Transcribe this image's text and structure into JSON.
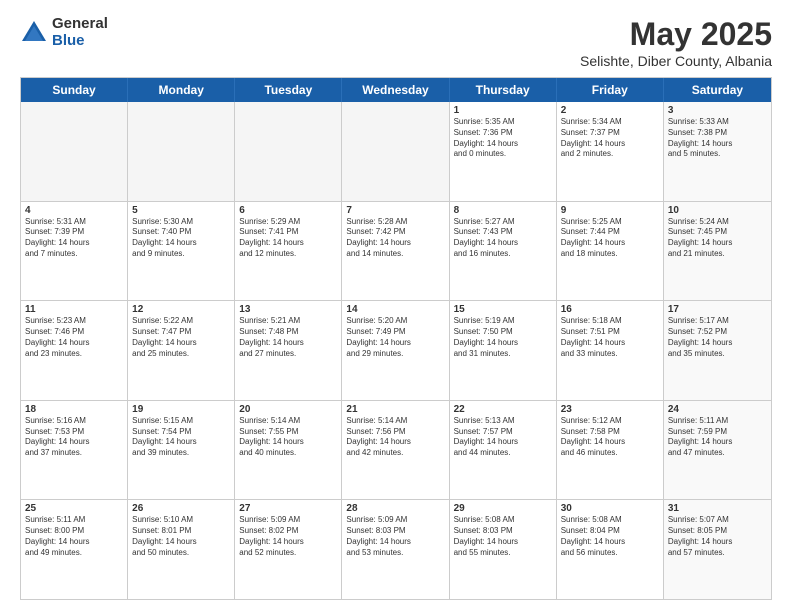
{
  "logo": {
    "general": "General",
    "blue": "Blue"
  },
  "header": {
    "title": "May 2025",
    "subtitle": "Selishte, Diber County, Albania"
  },
  "days": [
    "Sunday",
    "Monday",
    "Tuesday",
    "Wednesday",
    "Thursday",
    "Friday",
    "Saturday"
  ],
  "weeks": [
    [
      {
        "day": "",
        "text": "",
        "empty": true
      },
      {
        "day": "",
        "text": "",
        "empty": true
      },
      {
        "day": "",
        "text": "",
        "empty": true
      },
      {
        "day": "",
        "text": "",
        "empty": true
      },
      {
        "day": "1",
        "text": "Sunrise: 5:35 AM\nSunset: 7:36 PM\nDaylight: 14 hours\nand 0 minutes."
      },
      {
        "day": "2",
        "text": "Sunrise: 5:34 AM\nSunset: 7:37 PM\nDaylight: 14 hours\nand 2 minutes."
      },
      {
        "day": "3",
        "text": "Sunrise: 5:33 AM\nSunset: 7:38 PM\nDaylight: 14 hours\nand 5 minutes.",
        "shade": true
      }
    ],
    [
      {
        "day": "4",
        "text": "Sunrise: 5:31 AM\nSunset: 7:39 PM\nDaylight: 14 hours\nand 7 minutes."
      },
      {
        "day": "5",
        "text": "Sunrise: 5:30 AM\nSunset: 7:40 PM\nDaylight: 14 hours\nand 9 minutes."
      },
      {
        "day": "6",
        "text": "Sunrise: 5:29 AM\nSunset: 7:41 PM\nDaylight: 14 hours\nand 12 minutes."
      },
      {
        "day": "7",
        "text": "Sunrise: 5:28 AM\nSunset: 7:42 PM\nDaylight: 14 hours\nand 14 minutes."
      },
      {
        "day": "8",
        "text": "Sunrise: 5:27 AM\nSunset: 7:43 PM\nDaylight: 14 hours\nand 16 minutes."
      },
      {
        "day": "9",
        "text": "Sunrise: 5:25 AM\nSunset: 7:44 PM\nDaylight: 14 hours\nand 18 minutes."
      },
      {
        "day": "10",
        "text": "Sunrise: 5:24 AM\nSunset: 7:45 PM\nDaylight: 14 hours\nand 21 minutes.",
        "shade": true
      }
    ],
    [
      {
        "day": "11",
        "text": "Sunrise: 5:23 AM\nSunset: 7:46 PM\nDaylight: 14 hours\nand 23 minutes."
      },
      {
        "day": "12",
        "text": "Sunrise: 5:22 AM\nSunset: 7:47 PM\nDaylight: 14 hours\nand 25 minutes."
      },
      {
        "day": "13",
        "text": "Sunrise: 5:21 AM\nSunset: 7:48 PM\nDaylight: 14 hours\nand 27 minutes."
      },
      {
        "day": "14",
        "text": "Sunrise: 5:20 AM\nSunset: 7:49 PM\nDaylight: 14 hours\nand 29 minutes."
      },
      {
        "day": "15",
        "text": "Sunrise: 5:19 AM\nSunset: 7:50 PM\nDaylight: 14 hours\nand 31 minutes."
      },
      {
        "day": "16",
        "text": "Sunrise: 5:18 AM\nSunset: 7:51 PM\nDaylight: 14 hours\nand 33 minutes."
      },
      {
        "day": "17",
        "text": "Sunrise: 5:17 AM\nSunset: 7:52 PM\nDaylight: 14 hours\nand 35 minutes.",
        "shade": true
      }
    ],
    [
      {
        "day": "18",
        "text": "Sunrise: 5:16 AM\nSunset: 7:53 PM\nDaylight: 14 hours\nand 37 minutes."
      },
      {
        "day": "19",
        "text": "Sunrise: 5:15 AM\nSunset: 7:54 PM\nDaylight: 14 hours\nand 39 minutes."
      },
      {
        "day": "20",
        "text": "Sunrise: 5:14 AM\nSunset: 7:55 PM\nDaylight: 14 hours\nand 40 minutes."
      },
      {
        "day": "21",
        "text": "Sunrise: 5:14 AM\nSunset: 7:56 PM\nDaylight: 14 hours\nand 42 minutes."
      },
      {
        "day": "22",
        "text": "Sunrise: 5:13 AM\nSunset: 7:57 PM\nDaylight: 14 hours\nand 44 minutes."
      },
      {
        "day": "23",
        "text": "Sunrise: 5:12 AM\nSunset: 7:58 PM\nDaylight: 14 hours\nand 46 minutes."
      },
      {
        "day": "24",
        "text": "Sunrise: 5:11 AM\nSunset: 7:59 PM\nDaylight: 14 hours\nand 47 minutes.",
        "shade": true
      }
    ],
    [
      {
        "day": "25",
        "text": "Sunrise: 5:11 AM\nSunset: 8:00 PM\nDaylight: 14 hours\nand 49 minutes."
      },
      {
        "day": "26",
        "text": "Sunrise: 5:10 AM\nSunset: 8:01 PM\nDaylight: 14 hours\nand 50 minutes."
      },
      {
        "day": "27",
        "text": "Sunrise: 5:09 AM\nSunset: 8:02 PM\nDaylight: 14 hours\nand 52 minutes."
      },
      {
        "day": "28",
        "text": "Sunrise: 5:09 AM\nSunset: 8:03 PM\nDaylight: 14 hours\nand 53 minutes."
      },
      {
        "day": "29",
        "text": "Sunrise: 5:08 AM\nSunset: 8:03 PM\nDaylight: 14 hours\nand 55 minutes."
      },
      {
        "day": "30",
        "text": "Sunrise: 5:08 AM\nSunset: 8:04 PM\nDaylight: 14 hours\nand 56 minutes."
      },
      {
        "day": "31",
        "text": "Sunrise: 5:07 AM\nSunset: 8:05 PM\nDaylight: 14 hours\nand 57 minutes.",
        "shade": true
      }
    ]
  ]
}
